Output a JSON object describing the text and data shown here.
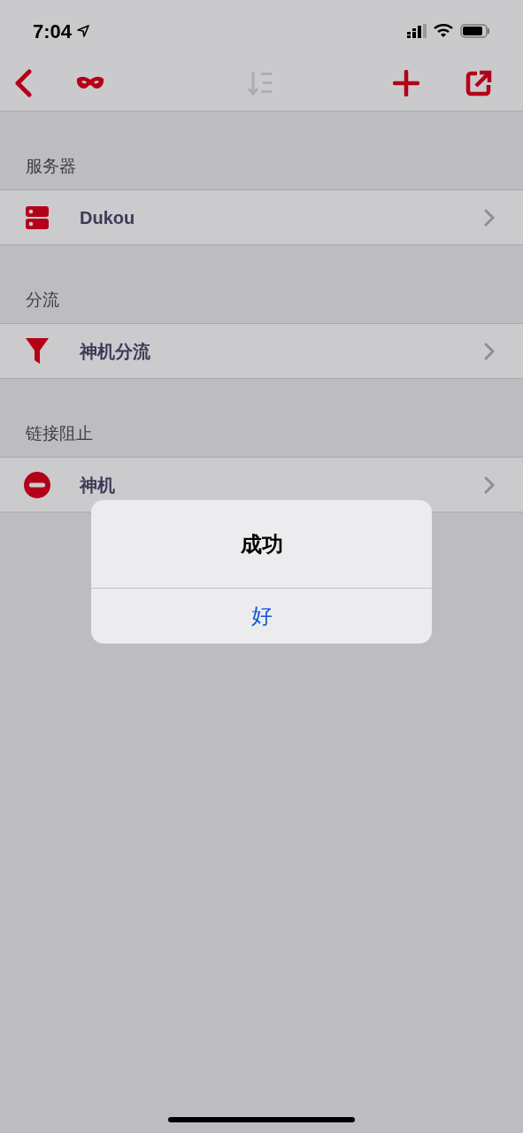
{
  "status_bar": {
    "time": "7:04"
  },
  "nav_buttons": [
    {
      "kind": "back",
      "disabled": false
    },
    {
      "kind": "mask",
      "disabled": false
    },
    {
      "kind": "sort",
      "disabled": true
    },
    {
      "kind": "add",
      "disabled": false
    },
    {
      "kind": "share",
      "disabled": false
    }
  ],
  "sections": [
    {
      "header": "服务器",
      "rows": [
        {
          "kind": "server",
          "label": "Dukou"
        }
      ]
    },
    {
      "header": "分流",
      "rows": [
        {
          "kind": "filter",
          "label": "神机分流"
        }
      ]
    },
    {
      "header": "链接阻止",
      "rows": [
        {
          "kind": "block",
          "label": "神机"
        }
      ]
    }
  ],
  "alert": {
    "title": "成功",
    "button": "好"
  }
}
